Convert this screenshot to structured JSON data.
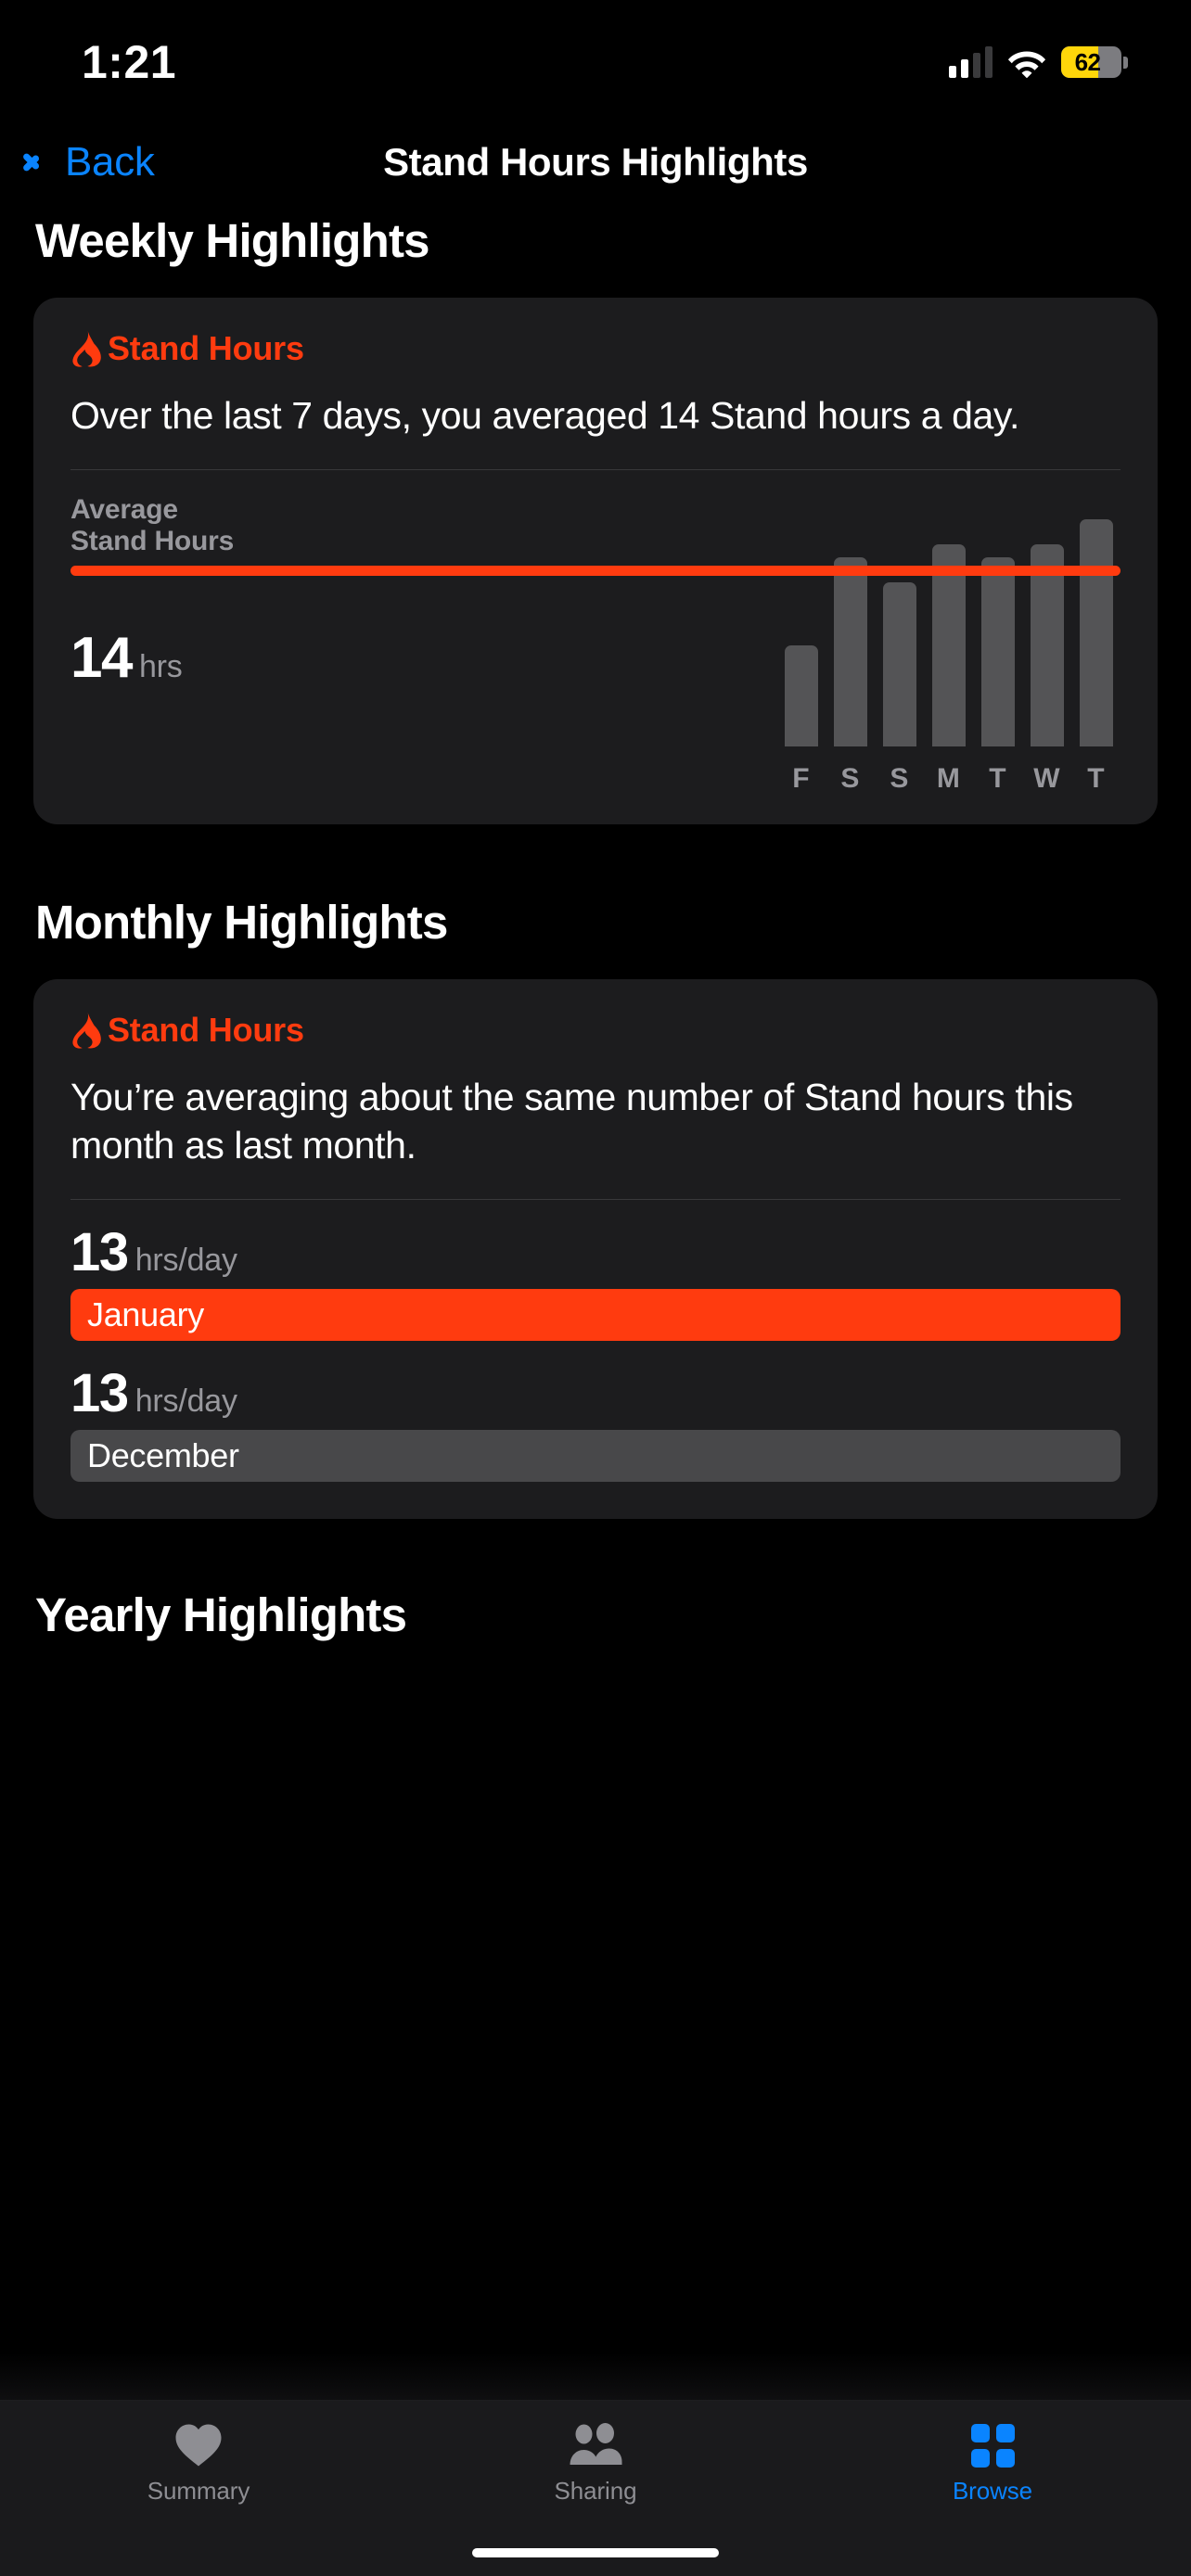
{
  "status_bar": {
    "time": "1:21",
    "signal_icon": "cellular-signal-icon",
    "wifi_icon": "wifi-icon",
    "battery_percent": "62",
    "battery_level": 62,
    "battery_color": "#ffd60a"
  },
  "nav": {
    "back_label": "Back",
    "back_icon": "chevron-left-icon",
    "title": "Stand Hours Highlights",
    "accent_color": "#0a84ff"
  },
  "weekly": {
    "section_title": "Weekly Highlights",
    "card": {
      "kicker": "Stand Hours",
      "kicker_icon": "flame-icon",
      "kicker_color": "#ff3b0f",
      "headline": "Over the last 7 days, you averaged 14 Stand hours a day.",
      "average_label": "Average\nStand Hours",
      "average_number": "14",
      "average_unit": "hrs"
    }
  },
  "monthly": {
    "section_title": "Monthly Highlights",
    "card": {
      "kicker": "Stand Hours",
      "kicker_icon": "flame-icon",
      "kicker_color": "#ff3b0f",
      "headline": "You’re averaging about the same number of Stand hours this month as last month.",
      "rows": [
        {
          "number": "13",
          "unit": "hrs/day",
          "label": "January",
          "bar_color": "#ff3b0f",
          "width_pct": 100
        },
        {
          "number": "13",
          "unit": "hrs/day",
          "label": "December",
          "bar_color": "#48484a",
          "width_pct": 100
        }
      ]
    }
  },
  "yearly": {
    "section_title": "Yearly Highlights"
  },
  "tab_bar": {
    "tabs": [
      {
        "label": "Summary",
        "icon": "heart-icon",
        "active": false
      },
      {
        "label": "Sharing",
        "icon": "people-icon",
        "active": false
      },
      {
        "label": "Browse",
        "icon": "grid-icon",
        "active": true
      }
    ],
    "active_color": "#0a84ff",
    "inactive_color": "#8e8e93"
  },
  "chart_data": {
    "type": "bar",
    "title": "Average Stand Hours",
    "xlabel": "",
    "ylabel": "Stand Hours",
    "categories": [
      "F",
      "S",
      "S",
      "M",
      "T",
      "W",
      "T"
    ],
    "values": [
      8,
      15,
      13,
      16,
      15,
      16,
      18
    ],
    "average": 14,
    "average_unit": "hrs",
    "average_line_color": "#ff3b0f",
    "bar_color": "#545456",
    "ylim": [
      0,
      20
    ],
    "grid": false,
    "legend": "none"
  }
}
